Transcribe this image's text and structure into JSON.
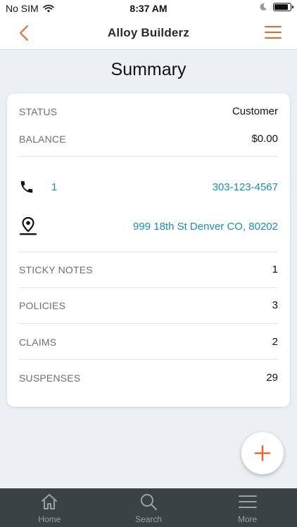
{
  "status_bar": {
    "carrier": "No SIM",
    "time": "8:37 AM",
    "battery_level": 0.9
  },
  "nav": {
    "title": "Alloy Builderz",
    "back_icon": "chevron-left-icon",
    "menu_icon": "hamburger-menu-icon"
  },
  "page": {
    "title": "Summary"
  },
  "summary": {
    "status_label": "STATUS",
    "status_value": "Customer",
    "balance_label": "BALANCE",
    "balance_value": "$0.00",
    "phone_count": "1",
    "phone_number": "303-123-4567",
    "address": "999 18th St Denver CO, 80202",
    "sticky_notes_label": "STICKY NOTES",
    "sticky_notes_value": "1",
    "policies_label": "POLICIES",
    "policies_value": "3",
    "claims_label": "CLAIMS",
    "claims_value": "2",
    "suspenses_label": "SUSPENSES",
    "suspenses_value": "29"
  },
  "fab": {
    "icon": "plus-icon"
  },
  "tabs": [
    {
      "label": "Home",
      "icon": "home-icon"
    },
    {
      "label": "Search",
      "icon": "search-icon"
    },
    {
      "label": "More",
      "icon": "hamburger-menu-icon"
    }
  ],
  "colors": {
    "accent": "#e8672a",
    "link": "#1a8bbf",
    "tab_bar": "#3a4246",
    "background": "#eaf0f3"
  }
}
